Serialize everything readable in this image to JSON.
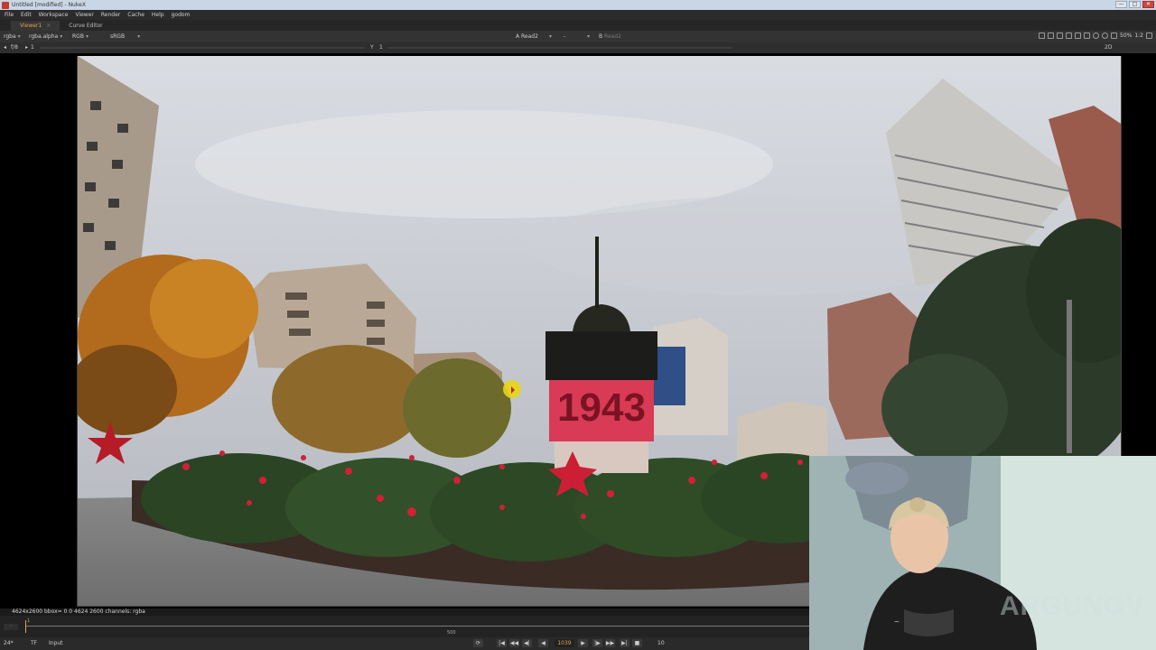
{
  "window": {
    "title": "Untitled [modified] - NukeX",
    "controls": [
      "—",
      "□",
      "✕"
    ]
  },
  "menubar": [
    "File",
    "Edit",
    "Workspace",
    "Viewer",
    "Render",
    "Cache",
    "Help",
    "godom"
  ],
  "tabs": [
    {
      "label": "Viewer1",
      "active": true
    },
    {
      "label": "Curve Editor",
      "active": false
    }
  ],
  "viewer_controls": {
    "channels": "rgba",
    "alpha_channel": "rgba.alpha",
    "display": "RGB",
    "colorspace": "sRGB",
    "input_a_label": "A",
    "input_a": "Read2",
    "input_b_sep": "-",
    "input_b_label": "B",
    "input_b": "Read2",
    "zoom": "50%",
    "proxy": "1:2",
    "view_mode": "2D"
  },
  "viewer_row2": {
    "fstop": "f/8",
    "gain": "1",
    "y_label": "Y",
    "gamma": "1"
  },
  "status": {
    "info": "4624x2600  bbox= 0 0 4624 2600 channels: rgba"
  },
  "timeline": {
    "start_frame": "1",
    "mid_label": "500",
    "playhead_frame": "1039"
  },
  "playback": {
    "fps": "24*",
    "tf": "TF",
    "input_mode": "Input",
    "current_frame": "1039",
    "increment": "10",
    "buttons": [
      "|◀",
      "◀◀",
      "◀|",
      "◀",
      "▶",
      "|▶",
      "▶▶",
      "▶|",
      "■"
    ]
  },
  "scene": {
    "monument_text": "1943"
  },
  "webcam": {
    "watermark": "ARGUNOV"
  },
  "colors": {
    "accent": "#e2a247",
    "titlebar": "#c9d6e5",
    "panel_bg": "#2b2b2b"
  }
}
